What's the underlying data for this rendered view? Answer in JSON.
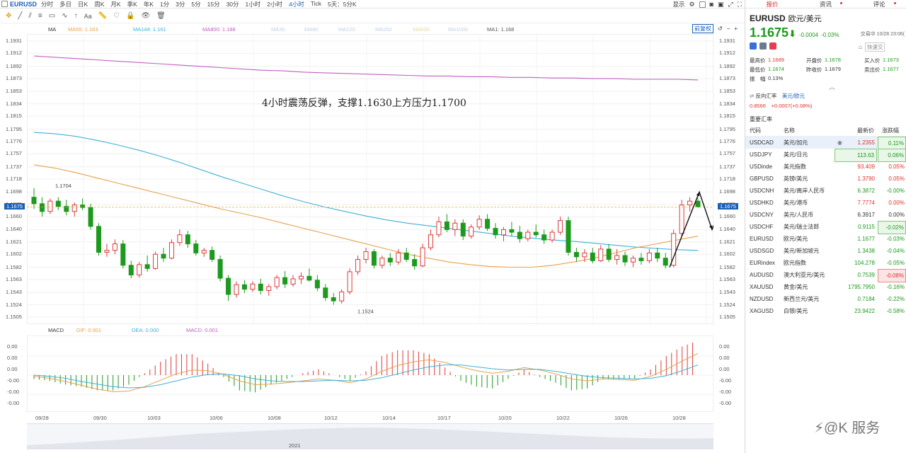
{
  "toolbar": {
    "symbol": "EURUSD",
    "timeframes": [
      "分时",
      "多日",
      "日K",
      "周K",
      "月K",
      "季K",
      "年K",
      "1分",
      "3分",
      "5分",
      "15分",
      "30分",
      "1小时",
      "2小时",
      "4小时",
      "Tick",
      "5天：5分K"
    ],
    "active_timeframe": "4小时",
    "display_label": "显示"
  },
  "tools": {
    "font_label": "Aa"
  },
  "ma_legend": {
    "label": "MA",
    "items": [
      {
        "text": "MA55: 1.163",
        "color": "#e8a04a"
      },
      {
        "text": "MA144: 1.161",
        "color": "#3fb0d8"
      },
      {
        "text": "MA800: 1.188",
        "color": "#c060c0"
      },
      {
        "text": "MA30",
        "color": "#bcd0e8"
      },
      {
        "text": "MA60",
        "color": "#bcd0e8"
      },
      {
        "text": "MA120",
        "color": "#bcd0e8"
      },
      {
        "text": "MA250",
        "color": "#bcd0e8"
      },
      {
        "text": "MA500",
        "color": "#e8d8a0"
      },
      {
        "text": "MA1000",
        "color": "#bcd0e8"
      },
      {
        "text": "MA1: 1.168",
        "color": "#555555"
      }
    ],
    "adjust_label": "前复权"
  },
  "annotation": "4小时震荡反弹，支撑1.1630上方压力1.1700",
  "price_labels": {
    "high": "1.1704",
    "low": "1.1524",
    "last": "1.1675"
  },
  "price_ticks": [
    "1.1931",
    "1.1912",
    "1.1892",
    "1.1873",
    "1.1853",
    "1.1834",
    "1.1815",
    "1.1795",
    "1.1776",
    "1.1757",
    "1.1737",
    "1.1718",
    "1.1698",
    "1.1679",
    "1.1660",
    "1.1640",
    "1.1621",
    "1.1602",
    "1.1582",
    "1.1563",
    "1.1543",
    "1.1524",
    "1.1505"
  ],
  "macd_legend": {
    "label": "MACD",
    "dif": "DIF: 0.001",
    "dea": "DEA: 0.000",
    "macd": "MACD: 0.001",
    "dif_color": "#e8a04a",
    "dea_color": "#3fb0d8",
    "macd_color": "#c060c0"
  },
  "macd_ticks": [
    "0.00",
    "0.00",
    "0.00",
    "-0.00",
    "-0.00",
    "-0.00"
  ],
  "dates": [
    "09/28",
    "09/30",
    "10/03",
    "10/06",
    "10/08",
    "10/12",
    "10/14",
    "10/17",
    "10/20",
    "10/22",
    "10/26",
    "10/28"
  ],
  "year_label": "2021",
  "side": {
    "tabs": [
      "报价",
      "资讯",
      "评论"
    ],
    "symbol": "EURUSD",
    "name": "欧元/美元",
    "price": "1.1675",
    "change": "-0.0004",
    "change_pct": "-0.03%",
    "status": "交易中 10/28 23:06(",
    "quick_label": "快速交",
    "stats": [
      {
        "label": "最高价",
        "value": "1.1689",
        "cls": "red"
      },
      {
        "label": "开盘价",
        "value": "1.1678",
        "cls": "green"
      },
      {
        "label": "买入价",
        "value": "1.1673",
        "cls": "green"
      },
      {
        "label": "最低价",
        "value": "1.1674",
        "cls": "green"
      },
      {
        "label": "昨收价",
        "value": "1.1679",
        "cls": ""
      },
      {
        "label": "卖出价",
        "value": "1.1677",
        "cls": "green"
      }
    ],
    "amplitude_label": "振　幅",
    "amplitude": "0.13%",
    "reverse_label": "反向汇率",
    "reverse_pair": "美元/欧元",
    "reverse_price": "0.8566",
    "reverse_change": "+0.0007(+0.08%)",
    "section_title": "重要汇率",
    "table_headers": [
      "代码",
      "名称",
      "最新价",
      "涨跌幅"
    ],
    "rows": [
      {
        "code": "USDCAD",
        "name": "美元/加元",
        "price": "1.2355",
        "pct": "0.11%",
        "pc": "red",
        "cc": "green",
        "sel": true
      },
      {
        "code": "USDJPY",
        "name": "美元/日元",
        "price": "113.63",
        "pct": "0.06%",
        "pc": "green",
        "cc": "green"
      },
      {
        "code": "USDinde",
        "name": "美元指数",
        "price": "93.409",
        "pct": "0.05%",
        "pc": "red",
        "cc": "red"
      },
      {
        "code": "GBPUSD",
        "name": "英镑/美元",
        "price": "1.3790",
        "pct": "0.05%",
        "pc": "red",
        "cc": "red"
      },
      {
        "code": "USDCNH",
        "name": "美元/离岸人民币",
        "price": "6.3872",
        "pct": "-0.00%",
        "pc": "green",
        "cc": "green"
      },
      {
        "code": "USDHKD",
        "name": "美元/港币",
        "price": "7.7774",
        "pct": "0.00%",
        "pc": "red",
        "cc": "red"
      },
      {
        "code": "USDCNY",
        "name": "美元/人民币",
        "price": "6.3917",
        "pct": "0.00%",
        "pc": "",
        "cc": ""
      },
      {
        "code": "USDCHF",
        "name": "美元/瑞士法郎",
        "price": "0.9115",
        "pct": "-0.02%",
        "pc": "green",
        "cc": "green"
      },
      {
        "code": "EURUSD",
        "name": "欧元/美元",
        "price": "1.1677",
        "pct": "-0.03%",
        "pc": "green",
        "cc": "green"
      },
      {
        "code": "USDSGD",
        "name": "美元/新加坡元",
        "price": "1.3438",
        "pct": "-0.04%",
        "pc": "green",
        "cc": "green"
      },
      {
        "code": "EURindex",
        "name": "欧元指数",
        "price": "104.278",
        "pct": "-0.05%",
        "pc": "green",
        "cc": "green"
      },
      {
        "code": "AUDUSD",
        "name": "澳大利亚元/美元",
        "price": "0.7539",
        "pct": "-0.08%",
        "pc": "green",
        "cc": "red"
      },
      {
        "code": "XAUUSD",
        "name": "黄金/美元",
        "price": "1795.7950",
        "pct": "-0.16%",
        "pc": "green",
        "cc": "green"
      },
      {
        "code": "NZDUSD",
        "name": "新西兰元/美元",
        "price": "0.7184",
        "pct": "-0.22%",
        "pc": "green",
        "cc": "green"
      },
      {
        "code": "XAGUSD",
        "name": "白银/美元",
        "price": "23.9422",
        "pct": "-0.58%",
        "pc": "green",
        "cc": "green"
      }
    ]
  },
  "watermark": "@K 服务",
  "chart_data": {
    "type": "candlestick",
    "ylim": [
      1.1505,
      1.1931
    ],
    "candles": [
      [
        1.169,
        1.1704,
        1.1672,
        1.168
      ],
      [
        1.168,
        1.169,
        1.166,
        1.1668
      ],
      [
        1.1668,
        1.1688,
        1.1664,
        1.1684
      ],
      [
        1.1684,
        1.169,
        1.167,
        1.1676
      ],
      [
        1.1676,
        1.1686,
        1.1662,
        1.1668
      ],
      [
        1.1668,
        1.1682,
        1.166,
        1.1678
      ],
      [
        1.1678,
        1.1688,
        1.167,
        1.1674
      ],
      [
        1.1674,
        1.168,
        1.164,
        1.1645
      ],
      [
        1.1645,
        1.165,
        1.16,
        1.1605
      ],
      [
        1.1605,
        1.1618,
        1.1598,
        1.1608
      ],
      [
        1.1608,
        1.1625,
        1.1602,
        1.1618
      ],
      [
        1.1618,
        1.1624,
        1.158,
        1.1585
      ],
      [
        1.1585,
        1.1592,
        1.1565,
        1.157
      ],
      [
        1.157,
        1.159,
        1.1566,
        1.1586
      ],
      [
        1.1586,
        1.16,
        1.1575,
        1.158
      ],
      [
        1.158,
        1.1606,
        1.1578,
        1.1602
      ],
      [
        1.1602,
        1.1612,
        1.159,
        1.1596
      ],
      [
        1.1596,
        1.1625,
        1.1594,
        1.162
      ],
      [
        1.162,
        1.164,
        1.1615,
        1.1632
      ],
      [
        1.1632,
        1.1638,
        1.1612,
        1.1618
      ],
      [
        1.1618,
        1.1624,
        1.16,
        1.1604
      ],
      [
        1.1604,
        1.1612,
        1.1598,
        1.1608
      ],
      [
        1.1608,
        1.1614,
        1.159,
        1.1594
      ],
      [
        1.1594,
        1.16,
        1.156,
        1.1565
      ],
      [
        1.1565,
        1.157,
        1.153,
        1.154
      ],
      [
        1.154,
        1.156,
        1.1535,
        1.1555
      ],
      [
        1.1555,
        1.1562,
        1.1542,
        1.1548
      ],
      [
        1.1548,
        1.156,
        1.1544,
        1.1556
      ],
      [
        1.1556,
        1.1564,
        1.154,
        1.1546
      ],
      [
        1.1546,
        1.1556,
        1.1538,
        1.1552
      ],
      [
        1.1552,
        1.157,
        1.1548,
        1.1566
      ],
      [
        1.1566,
        1.1576,
        1.155,
        1.1556
      ],
      [
        1.1556,
        1.157,
        1.1552,
        1.1564
      ],
      [
        1.1564,
        1.1574,
        1.1556,
        1.1568
      ],
      [
        1.1568,
        1.158,
        1.156,
        1.1562
      ],
      [
        1.1562,
        1.157,
        1.1545,
        1.155
      ],
      [
        1.155,
        1.1556,
        1.153,
        1.1535
      ],
      [
        1.1535,
        1.1542,
        1.1524,
        1.153
      ],
      [
        1.153,
        1.1548,
        1.1526,
        1.1544
      ],
      [
        1.1544,
        1.158,
        1.154,
        1.1575
      ],
      [
        1.1575,
        1.16,
        1.157,
        1.1594
      ],
      [
        1.1594,
        1.1612,
        1.1588,
        1.1606
      ],
      [
        1.1606,
        1.161,
        1.158,
        1.1585
      ],
      [
        1.1585,
        1.16,
        1.158,
        1.1596
      ],
      [
        1.1596,
        1.1604,
        1.1584,
        1.159
      ],
      [
        1.159,
        1.161,
        1.1586,
        1.1604
      ],
      [
        1.1604,
        1.1612,
        1.159,
        1.1594
      ],
      [
        1.1594,
        1.1602,
        1.1578,
        1.1584
      ],
      [
        1.1584,
        1.1618,
        1.1582,
        1.1612
      ],
      [
        1.1612,
        1.164,
        1.1608,
        1.1632
      ],
      [
        1.1632,
        1.166,
        1.1628,
        1.1652
      ],
      [
        1.1652,
        1.1664,
        1.1636,
        1.164
      ],
      [
        1.164,
        1.1656,
        1.163,
        1.165
      ],
      [
        1.165,
        1.1656,
        1.1624,
        1.163
      ],
      [
        1.163,
        1.1648,
        1.1626,
        1.1644
      ],
      [
        1.1644,
        1.1662,
        1.164,
        1.1656
      ],
      [
        1.1656,
        1.1664,
        1.1638,
        1.1642
      ],
      [
        1.1642,
        1.165,
        1.1626,
        1.1632
      ],
      [
        1.1632,
        1.1644,
        1.1622,
        1.164
      ],
      [
        1.164,
        1.1652,
        1.163,
        1.1636
      ],
      [
        1.1636,
        1.1646,
        1.162,
        1.1626
      ],
      [
        1.1626,
        1.164,
        1.1622,
        1.1636
      ],
      [
        1.1636,
        1.1648,
        1.1628,
        1.1632
      ],
      [
        1.1632,
        1.164,
        1.1618,
        1.1624
      ],
      [
        1.1624,
        1.164,
        1.162,
        1.1636
      ],
      [
        1.1636,
        1.166,
        1.1632,
        1.1654
      ],
      [
        1.1654,
        1.166,
        1.16,
        1.1605
      ],
      [
        1.1605,
        1.1612,
        1.159,
        1.1598
      ],
      [
        1.1598,
        1.161,
        1.159,
        1.1604
      ],
      [
        1.1604,
        1.1612,
        1.1588,
        1.1592
      ],
      [
        1.1592,
        1.1616,
        1.159,
        1.161
      ],
      [
        1.161,
        1.1618,
        1.159,
        1.1594
      ],
      [
        1.1594,
        1.161,
        1.1586,
        1.16
      ],
      [
        1.16,
        1.1606,
        1.1584,
        1.159
      ],
      [
        1.159,
        1.16,
        1.1582,
        1.1596
      ],
      [
        1.1596,
        1.1604,
        1.1586,
        1.1592
      ],
      [
        1.1592,
        1.161,
        1.1588,
        1.1604
      ],
      [
        1.1604,
        1.1612,
        1.159,
        1.1596
      ],
      [
        1.1596,
        1.1604,
        1.158,
        1.1585
      ],
      [
        1.1585,
        1.164,
        1.1582,
        1.1634
      ],
      [
        1.1634,
        1.1686,
        1.163,
        1.1678
      ],
      [
        1.1678,
        1.169,
        1.1668,
        1.1684
      ],
      [
        1.1684,
        1.1689,
        1.1674,
        1.1675
      ]
    ],
    "ma55": [
      1.174,
      1.1735,
      1.1728,
      1.172,
      1.1712,
      1.1704,
      1.1696,
      1.1688,
      1.168,
      1.1672,
      1.1665,
      1.1658,
      1.165,
      1.1642,
      1.1634,
      1.1626,
      1.1618,
      1.161,
      1.1602,
      1.1596,
      1.159,
      1.1586,
      1.1583,
      1.1582,
      1.1582,
      1.1585,
      1.159,
      1.1596,
      1.1604,
      1.1612,
      1.1618,
      1.1624,
      1.163
    ],
    "ma144": [
      1.179,
      1.1788,
      1.1784,
      1.1778,
      1.1771,
      1.1763,
      1.1754,
      1.1744,
      1.1733,
      1.1722,
      1.1712,
      1.1702,
      1.1692,
      1.1683,
      1.1675,
      1.1668,
      1.1661,
      1.1655,
      1.165,
      1.1646,
      1.1642,
      1.1638,
      1.1634,
      1.163,
      1.1627,
      1.1624,
      1.1622,
      1.1619,
      1.1616,
      1.1613,
      1.1611,
      1.1609,
      1.1608
    ],
    "ma800": [
      1.1908,
      1.1906,
      1.1904,
      1.1902,
      1.19,
      1.1898,
      1.1896,
      1.1894,
      1.1892,
      1.189,
      1.1888,
      1.1886,
      1.1885,
      1.1883,
      1.1882,
      1.1881,
      1.188,
      1.1879,
      1.1878,
      1.1877,
      1.1877,
      1.1876,
      1.1876,
      1.1875,
      1.1875,
      1.1874,
      1.1874,
      1.1873,
      1.1873,
      1.1872,
      1.1872,
      1.1872,
      1.1871
    ],
    "macd_dif": [
      -0.2,
      -0.5,
      -1.0,
      -1.6,
      -2.2,
      -2.6,
      -2.5,
      -1.8,
      -0.8,
      0.2,
      0.8,
      0.7,
      0.1,
      -0.9,
      -1.5,
      -1.4,
      -1.2,
      -0.9,
      -0.6,
      -0.8,
      -1.2,
      -0.6,
      0.6,
      1.5,
      2.1,
      2.4,
      2.0,
      1.3,
      0.7,
      0.3,
      0.6,
      1.2,
      0.8,
      0.2,
      -0.6,
      -0.9,
      -0.6,
      -0.7,
      -0.8,
      -0.2,
      0.9,
      2.2,
      3.4
    ],
    "macd_dea": [
      0.0,
      -0.2,
      -0.5,
      -1.0,
      -1.4,
      -1.8,
      -2.0,
      -1.9,
      -1.5,
      -0.9,
      -0.3,
      0.1,
      0.2,
      -0.1,
      -0.6,
      -0.9,
      -1.0,
      -1.0,
      -0.9,
      -0.8,
      -0.9,
      -0.8,
      -0.4,
      0.2,
      0.8,
      1.3,
      1.6,
      1.6,
      1.3,
      1.0,
      0.8,
      0.9,
      0.9,
      0.6,
      0.2,
      -0.2,
      -0.4,
      -0.5,
      -0.6,
      -0.5,
      -0.1,
      0.7,
      1.6
    ]
  }
}
